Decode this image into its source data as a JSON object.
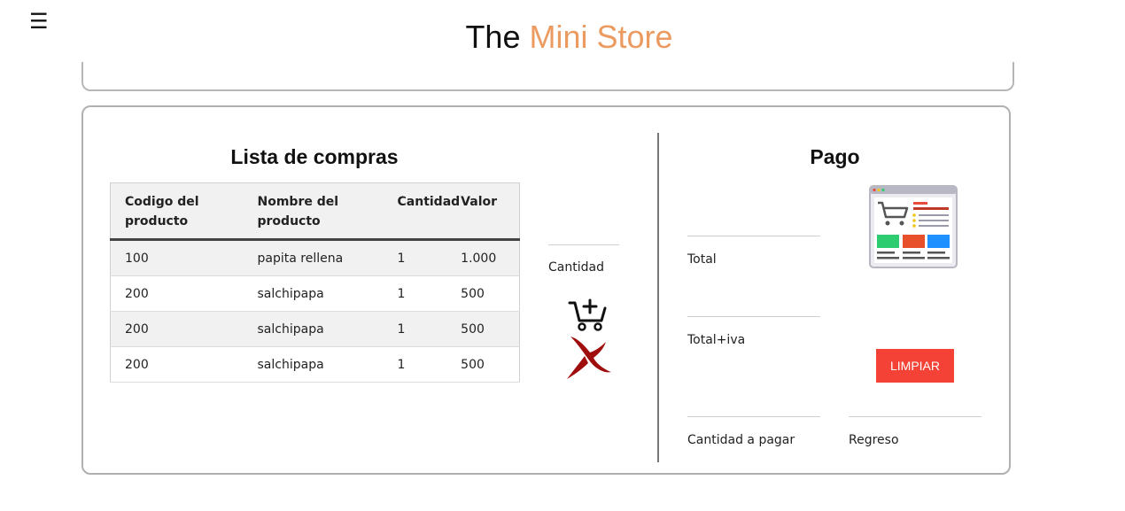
{
  "header": {
    "menu_icon": "☰",
    "brand_prefix": "The",
    "brand_accent": "Mini Store",
    "accent_color": "#eb9b60"
  },
  "list": {
    "title": "Lista de compras",
    "columns": [
      "Codigo del producto",
      "Nombre del producto",
      "Cantidad",
      "Valor"
    ],
    "rows": [
      {
        "codigo": "100",
        "nombre": "papita rellena",
        "cantidad": "1",
        "valor": "1.000"
      },
      {
        "codigo": "200",
        "nombre": "salchipapa",
        "cantidad": "1",
        "valor": "500"
      },
      {
        "codigo": "200",
        "nombre": "salchipapa",
        "cantidad": "1",
        "valor": "500"
      },
      {
        "codigo": "200",
        "nombre": "salchipapa",
        "cantidad": "1",
        "valor": "500"
      }
    ]
  },
  "quantity": {
    "label": "Cantidad",
    "value": "",
    "add_icon": "cart-add-icon",
    "remove_icon": "remove-x-icon"
  },
  "payment": {
    "title": "Pago",
    "total_label": "Total",
    "total_value": "",
    "total_iva_label": "Total+iva",
    "total_iva_value": "",
    "cantidad_pagar_label": "Cantidad a pagar",
    "cantidad_pagar_value": "",
    "regreso_label": "Regreso",
    "regreso_value": "",
    "clear_button": "LIMPIAR",
    "clear_button_color": "#f44336",
    "image_icon": "online-store-icon"
  }
}
